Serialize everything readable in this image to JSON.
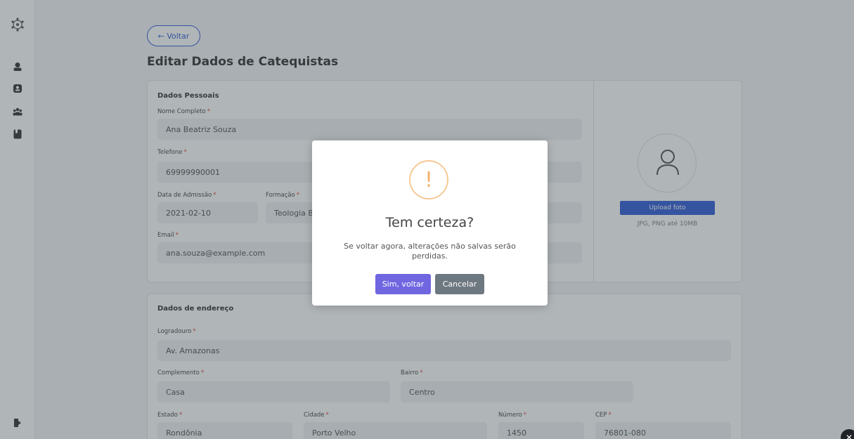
{
  "back_button": {
    "label": "← Voltar"
  },
  "page_title": "Editar Dados de Catequistas",
  "personal": {
    "section_title": "Dados Pessoais",
    "nome_label": "Nome Completo",
    "nome_value": "Ana Beatriz Souza",
    "telefone_label": "Telefone",
    "telefone_value": "69999990001",
    "admissao_label": "Data de Admissão",
    "admissao_value": "2021-02-10",
    "formacao_label": "Formação",
    "formacao_value": "Teologia Ba",
    "email_label": "Email",
    "email_value": "ana.souza@example.com",
    "required_mark": "*"
  },
  "photo": {
    "upload_label": "Upload foto",
    "hint": "JPG, PNG até 10MB"
  },
  "address": {
    "section_title": "Dados de endereço",
    "logradouro_label": "Logradouro",
    "logradouro_value": "Av. Amazonas",
    "complemento_label": "Complemento",
    "complemento_value": "Casa",
    "bairro_label": "Bairro",
    "bairro_value": "Centro",
    "estado_label": "Estado",
    "estado_value": "Rondônia",
    "cidade_label": "Cidade",
    "cidade_value": "Porto Velho",
    "numero_label": "Número",
    "numero_value": "1450",
    "cep_label": "CEP",
    "cep_value": "76801-080"
  },
  "modal": {
    "icon_glyph": "!",
    "title": "Tem certeza?",
    "text": "Se voltar agora, alterações não salvas serão perdidas.",
    "confirm_label": "Sim, voltar",
    "cancel_label": "Cancelar"
  },
  "colors": {
    "primary": "#1f4fd6",
    "confirm": "#7066e0",
    "cancel": "#6e7881",
    "warning": "#f8bb86"
  }
}
